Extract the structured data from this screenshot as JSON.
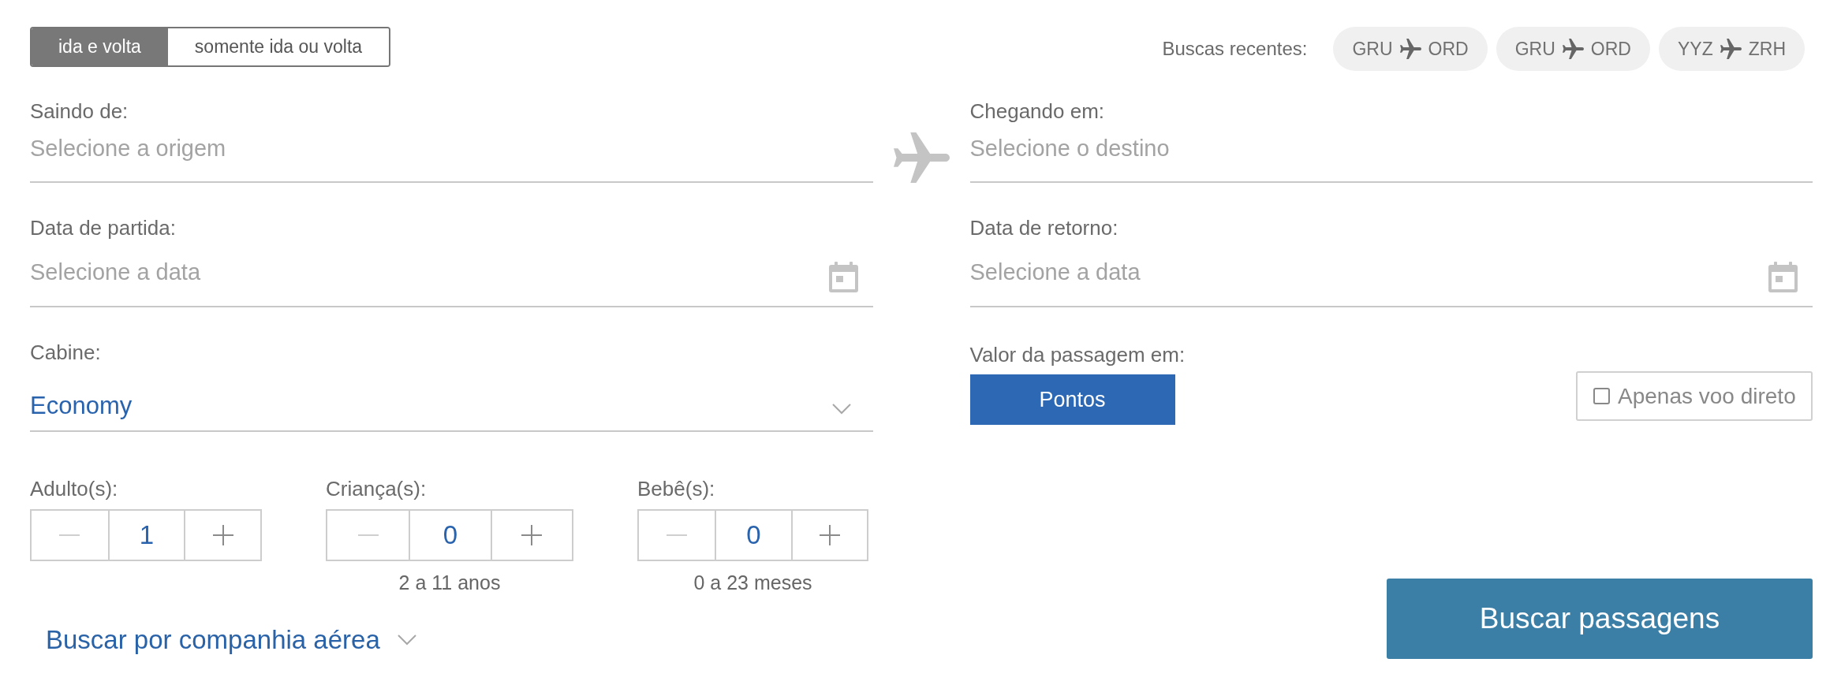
{
  "trip_type_tabs": [
    {
      "label": "ida e volta",
      "selected": true
    },
    {
      "label": "somente ida ou volta",
      "selected": false
    }
  ],
  "recent_searches": {
    "label": "Buscas recentes:",
    "items": [
      {
        "from": "GRU",
        "to": "ORD"
      },
      {
        "from": "GRU",
        "to": "ORD"
      },
      {
        "from": "YYZ",
        "to": "ZRH"
      }
    ]
  },
  "fields_left": [
    {
      "kind": "text",
      "label": "Saindo de:",
      "placeholder": "Selecione a origem"
    },
    {
      "kind": "date",
      "label": "Data de partida:",
      "placeholder": "Selecione a data"
    },
    {
      "kind": "select",
      "label": "Cabine:",
      "value": "Economy"
    }
  ],
  "fields_right": [
    {
      "kind": "text",
      "label": "Chegando em:",
      "placeholder": "Selecione o destino"
    },
    {
      "kind": "date",
      "label": "Data de retorno:",
      "placeholder": "Selecione a data"
    }
  ],
  "passengers": [
    {
      "label": "Adulto(s):",
      "value": "1",
      "minus_disabled": true
    },
    {
      "label": "Criança(s):",
      "value": "0",
      "minus_disabled": true,
      "note": "2 a 11 anos"
    },
    {
      "label": "Bebê(s):",
      "value": "0",
      "minus_disabled": true,
      "note": "0 a 23 meses"
    }
  ],
  "airline_link": {
    "label": "Buscar por companhia aérea",
    "expanded": false
  },
  "fare_currency": {
    "label": "Valor da passagem em:",
    "options": [
      {
        "label": "Pontos",
        "selected": true
      }
    ]
  },
  "direct_only": {
    "label": "Apenas voo direto",
    "checked": false
  },
  "search_button": {
    "label": "Buscar passagens"
  }
}
